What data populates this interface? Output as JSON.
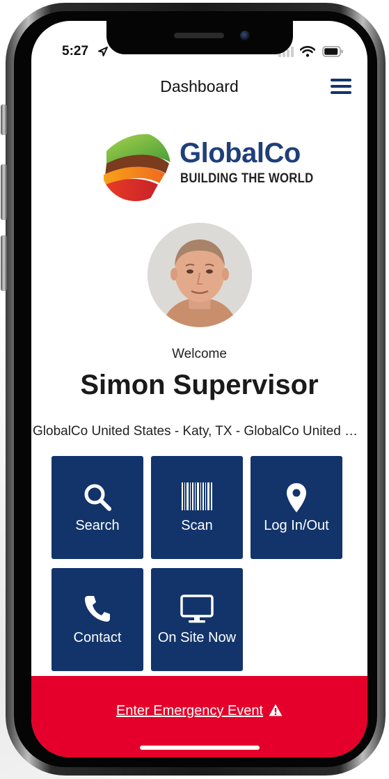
{
  "status_bar": {
    "time": "5:27"
  },
  "header": {
    "title": "Dashboard",
    "menu_icon": "hamburger-menu-icon"
  },
  "logo": {
    "name": "GlobalCo",
    "tagline": "BUILDING THE WORLD"
  },
  "profile": {
    "welcome": "Welcome",
    "name": "Simon Supervisor",
    "location": "GlobalCo United States - Katy, TX - GlobalCo United States"
  },
  "tiles": [
    {
      "label": "Search",
      "icon": "search-icon"
    },
    {
      "label": "Scan",
      "icon": "barcode-icon"
    },
    {
      "label": "Log In/Out",
      "icon": "map-pin-icon"
    },
    {
      "label": "Contact",
      "icon": "phone-icon"
    },
    {
      "label": "On Site Now",
      "icon": "monitor-icon"
    }
  ],
  "emergency": {
    "label": "Enter Emergency Event",
    "icon": "warning-icon"
  },
  "colors": {
    "primary": "#12346a",
    "emergency": "#e4002b",
    "logo_text": "#1f3f7a"
  }
}
